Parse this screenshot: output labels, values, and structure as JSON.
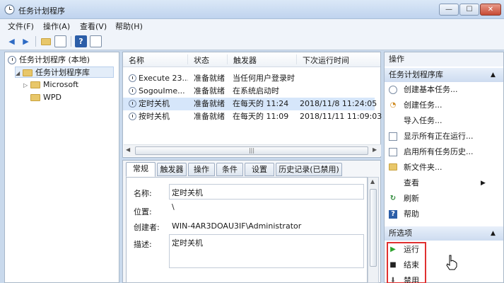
{
  "window": {
    "title": "任务计划程序",
    "btn_min": "—",
    "btn_max": "☐",
    "btn_close": "✕"
  },
  "menu": [
    "文件(F)",
    "操作(A)",
    "查看(V)",
    "帮助(H)"
  ],
  "toolbar_icons": [
    "back-arrow-icon",
    "forward-arrow-icon",
    "folder-up-icon",
    "show-hide-tree-icon",
    "help-icon",
    "properties-icon"
  ],
  "tree": {
    "root": "任务计划程序 (本地)",
    "library": "任务计划程序库",
    "children": [
      "Microsoft",
      "WPD"
    ]
  },
  "tasklist": {
    "columns": [
      "名称",
      "状态",
      "触发器",
      "下次运行时间"
    ],
    "rows": [
      {
        "name": "Execute 23...",
        "status": "准备就绪",
        "trigger": "当任何用户登录时",
        "next": ""
      },
      {
        "name": "SogouIme...",
        "status": "准备就绪",
        "trigger": "在系统启动时",
        "next": ""
      },
      {
        "name": "定时关机",
        "status": "准备就绪",
        "trigger": "在每天的 11:24",
        "next": "2018/11/8 11:24:05"
      },
      {
        "name": "按时关机",
        "status": "准备就绪",
        "trigger": "在每天的 11:09",
        "next": "2018/11/11 11:09:03"
      }
    ],
    "scroll_grip": "|||"
  },
  "details": {
    "tabs": [
      "常规",
      "触发器",
      "操作",
      "条件",
      "设置",
      "历史记录(已禁用)"
    ],
    "fields": [
      {
        "label": "名称:",
        "value": "定时关机"
      },
      {
        "label": "位置:",
        "value": "\\"
      },
      {
        "label": "创建者:",
        "value": "WIN-4AR3DOAU3IF\\Administrator"
      },
      {
        "label": "描述:",
        "value": "定时关机"
      }
    ]
  },
  "actions": {
    "header": "操作",
    "section1": "任务计划程序库",
    "items1": [
      {
        "label": "创建基本任务...",
        "icon": "create-basic-task-icon"
      },
      {
        "label": "创建任务...",
        "icon": "create-task-icon"
      },
      {
        "label": "导入任务...",
        "icon": "import-icon"
      },
      {
        "label": "显示所有正在运行...",
        "icon": "running-tasks-icon"
      },
      {
        "label": "启用所有任务历史...",
        "icon": "history-icon"
      },
      {
        "label": "新文件夹...",
        "icon": "new-folder-icon"
      },
      {
        "label": "查看",
        "icon": "view-icon"
      },
      {
        "label": "刷新",
        "icon": "refresh-icon"
      },
      {
        "label": "帮助",
        "icon": "help-icon"
      }
    ],
    "section2": "所选项",
    "items2": [
      {
        "label": "运行",
        "icon": "run-icon"
      },
      {
        "label": "结束",
        "icon": "stop-icon"
      },
      {
        "label": "禁用",
        "icon": "disable-icon"
      }
    ]
  },
  "colors": {
    "accent": "#3b7bd4",
    "highlight_box": "#e03030",
    "run_green": "#2ea32e"
  }
}
